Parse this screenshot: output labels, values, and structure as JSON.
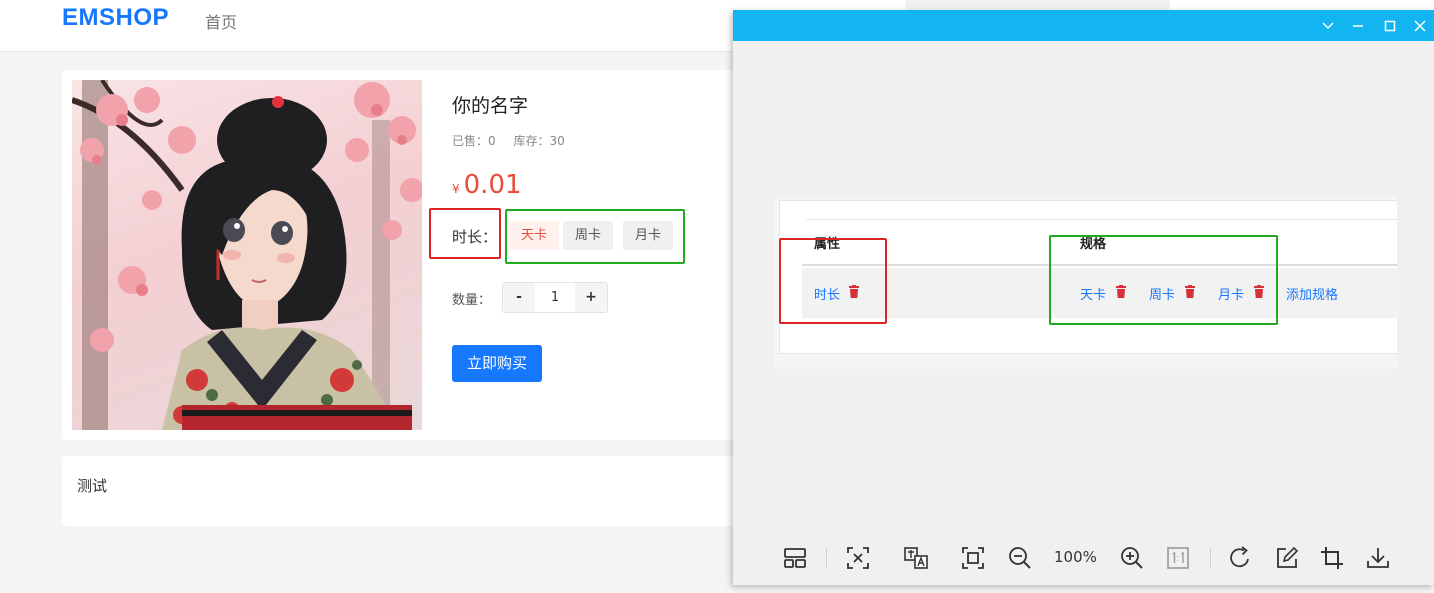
{
  "header": {
    "logo": "EMSHOP",
    "nav_home": "首页"
  },
  "product": {
    "title": "你的名字",
    "sold_label": "已售：0",
    "stock_label": "库存：30",
    "currency": "¥",
    "price": "0.01",
    "duration_label": "时长：",
    "duration_options": [
      "天卡",
      "周卡",
      "月卡"
    ],
    "selected_duration": "天卡",
    "quantity_label": "数量：",
    "quantity_minus": "-",
    "quantity_value": "1",
    "quantity_plus": "+",
    "buy_button": "立即购买"
  },
  "description": {
    "text": "测试"
  },
  "viewer": {
    "titlebar_color": "#13b5f0",
    "table": {
      "header_attr": "属性",
      "header_spec": "规格",
      "attr_name": "时长",
      "specs": [
        "天卡",
        "周卡",
        "月卡"
      ],
      "add_spec": "添加规格"
    },
    "zoom_level": "100%",
    "toolbar_icons": [
      "layout-icon",
      "fit-icon",
      "translate-icon",
      "fullscreen-icon",
      "zoom-out-icon",
      "zoom-in-icon",
      "actual-size-icon",
      "rotate-icon",
      "edit-icon",
      "crop-icon",
      "download-icon"
    ]
  },
  "colors": {
    "brand": "#1677ff",
    "price": "#e74c3c",
    "annotation_red": "#e02424",
    "annotation_green": "#1faa1f"
  }
}
